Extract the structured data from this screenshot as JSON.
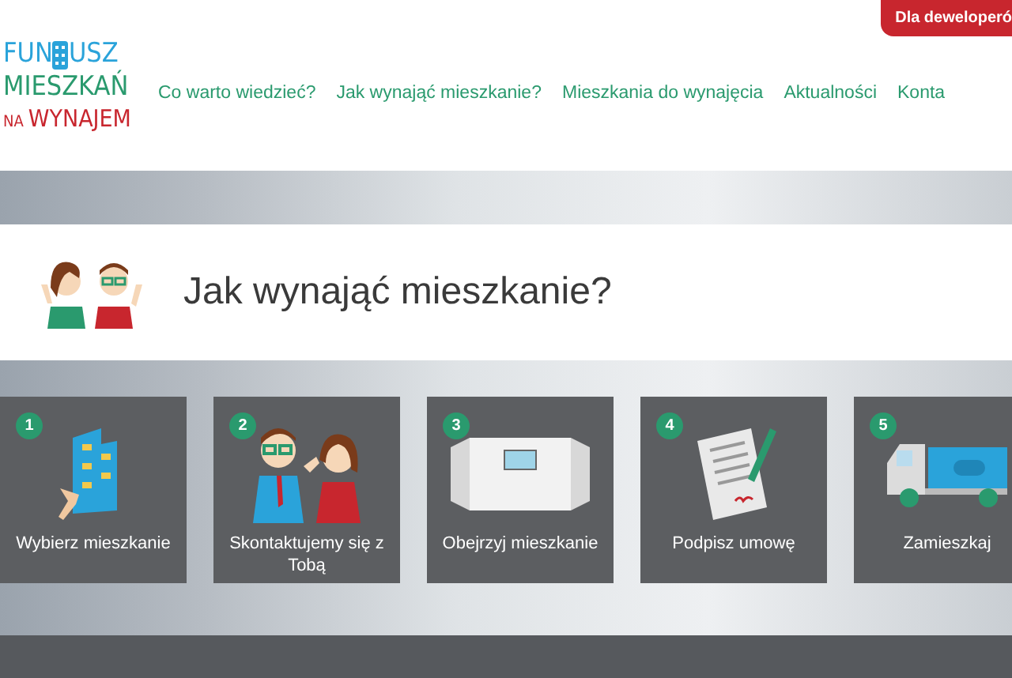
{
  "header": {
    "logo": {
      "line1_start": "FUN",
      "line1_end": "USZ",
      "line2": "MIESZKAŃ",
      "line3_small": "NA",
      "line3": "WYNAJEM"
    },
    "developer_button": "Dla deweloperó",
    "nav": [
      "Co warto wiedzieć?",
      "Jak wynająć mieszkanie?",
      "Mieszkania do wynajęcia",
      "Aktualności",
      "Konta"
    ]
  },
  "title_card": {
    "title": "Jak wynająć mieszkanie?"
  },
  "steps": [
    {
      "number": "1",
      "label": "Wybierz mieszkanie",
      "kind": "building"
    },
    {
      "number": "2",
      "label": "Skontaktujemy się z Tobą",
      "kind": "people"
    },
    {
      "number": "3",
      "label": "Obejrzyj mieszkanie",
      "kind": "room"
    },
    {
      "number": "4",
      "label": "Podpisz umowę",
      "kind": "contract"
    },
    {
      "number": "5",
      "label": "Zamieszkaj",
      "kind": "truck"
    }
  ]
}
